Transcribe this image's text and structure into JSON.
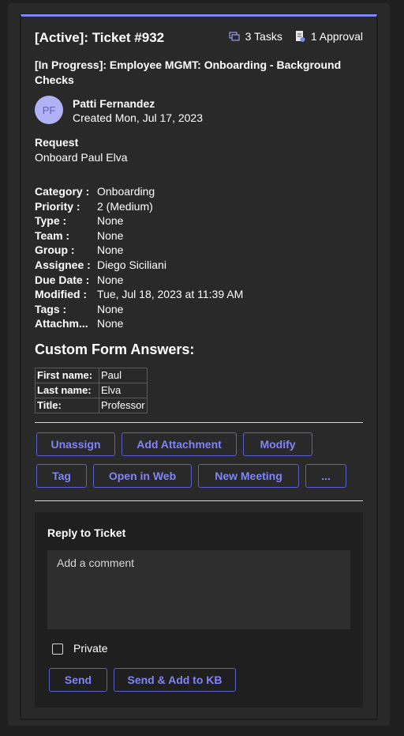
{
  "ticket": {
    "title": "[Active]: Ticket #932",
    "tasks": "3 Tasks",
    "approvals": "1 Approval",
    "subtitle": "[In Progress]: Employee MGMT: Onboarding - Background Checks",
    "avatar_initials": "PF",
    "creator": "Patti Fernandez",
    "created": "Created Mon, Jul 17, 2023",
    "request_label": "Request",
    "request_value": "Onboard Paul Elva"
  },
  "fields": [
    {
      "label": "Category :",
      "value": "Onboarding"
    },
    {
      "label": "Priority :",
      "value": "2 (Medium)"
    },
    {
      "label": "Type :",
      "value": "None"
    },
    {
      "label": "Team :",
      "value": "None"
    },
    {
      "label": "Group :",
      "value": "None"
    },
    {
      "label": "Assignee :",
      "value": "Diego Siciliani"
    },
    {
      "label": "Due Date :",
      "value": "None"
    },
    {
      "label": "Modified :",
      "value": "Tue, Jul 18, 2023 at 11:39 AM"
    },
    {
      "label": "Tags :",
      "value": "None"
    },
    {
      "label": "Attachm...",
      "value": "None"
    }
  ],
  "custom_form": {
    "title": "Custom Form Answers:",
    "rows": [
      {
        "key": "First name:",
        "value": "Paul"
      },
      {
        "key": "Last name:",
        "value": "Elva"
      },
      {
        "key": "Title:",
        "value": "Professor"
      }
    ]
  },
  "actions": {
    "unassign": "Unassign",
    "add_attachment": "Add Attachment",
    "modify": "Modify",
    "tag": "Tag",
    "open_in_web": "Open in Web",
    "new_meeting": "New Meeting",
    "more": "..."
  },
  "reply": {
    "title": "Reply to Ticket",
    "placeholder": "Add a comment",
    "private_label": "Private",
    "send": "Send",
    "send_kb": "Send & Add to KB"
  },
  "colors": {
    "accent": "#7f85f5",
    "background": "#292929"
  }
}
